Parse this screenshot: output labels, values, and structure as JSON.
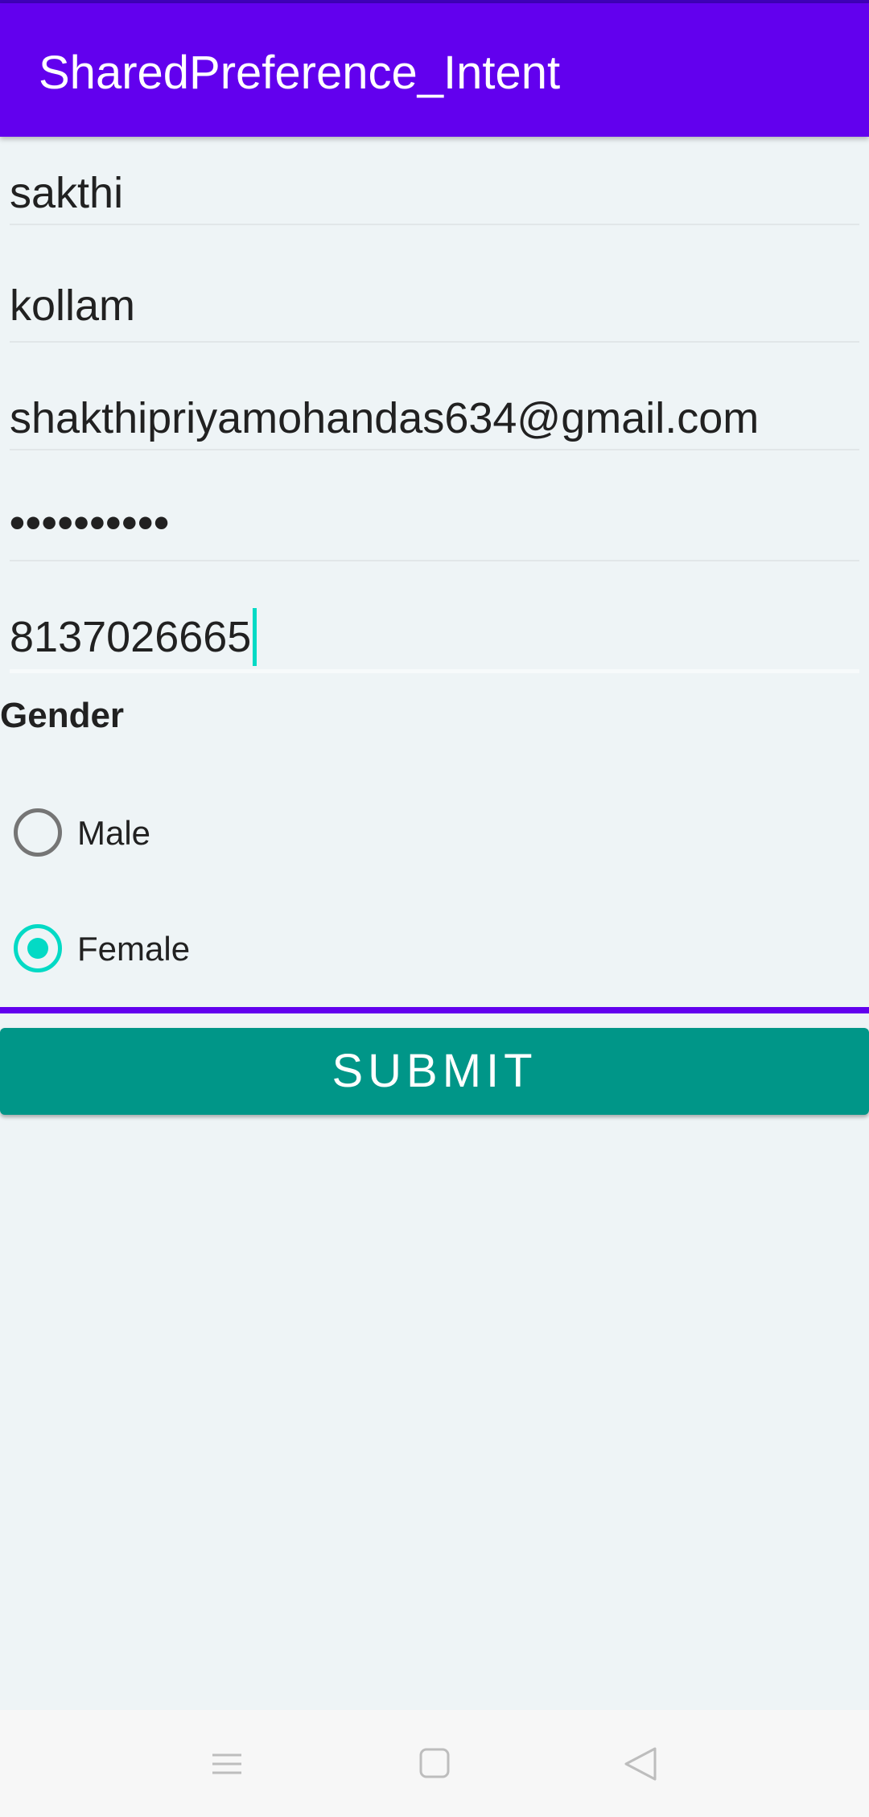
{
  "app_bar": {
    "title": "SharedPreference_Intent",
    "color": "#6200ee"
  },
  "form": {
    "name_value": "sakthi",
    "city_value": "kollam",
    "email_value": "shakthipriyamohandas634@gmail.com",
    "password_mask": "••••••••••",
    "phone_value": "8137026665"
  },
  "gender": {
    "label": "Gender",
    "options": [
      {
        "label": "Male",
        "selected": false
      },
      {
        "label": "Female",
        "selected": true
      }
    ],
    "accent_color": "#03dac5"
  },
  "submit": {
    "label": "SUBMIT",
    "color": "#009688"
  },
  "nav_bar": {
    "icons": [
      "menu-icon",
      "home-icon",
      "back-icon"
    ]
  }
}
